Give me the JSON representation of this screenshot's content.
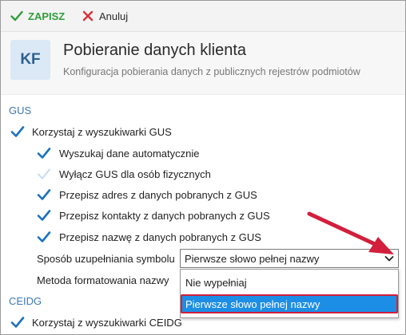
{
  "toolbar": {
    "save_label": "ZAPISZ",
    "cancel_label": "Anuluj"
  },
  "header": {
    "badge": "KF",
    "title": "Pobieranie danych klienta",
    "subtitle": "Konfiguracja pobierania danych z publicznych rejestrów podmiotów"
  },
  "gus": {
    "section_label": "GUS",
    "use_search": {
      "label": "Korzystaj z wyszukiwarki GUS",
      "checked": true
    },
    "options": [
      {
        "label": "Wyszukaj dane automatycznie",
        "checked": true
      },
      {
        "label": "Wyłącz GUS dla osób fizycznych",
        "checked": false
      },
      {
        "label": "Przepisz adres z danych pobranych z GUS",
        "checked": true
      },
      {
        "label": "Przepisz kontakty z danych pobranych z GUS",
        "checked": true
      },
      {
        "label": "Przepisz nazwę z danych pobranych z GUS",
        "checked": true
      }
    ],
    "symbol_field": {
      "label": "Sposób uzupełniania symbolu",
      "value": "Pierwsze słowo pełnej nazwy",
      "dropdown_options": [
        "Nie wypełniaj",
        "Pierwsze słowo pełnej nazwy"
      ],
      "highlighted_option": "Pierwsze słowo pełnej nazwy"
    },
    "format_field": {
      "label": "Metoda formatowania nazwy"
    }
  },
  "ceidg": {
    "section_label": "CEIDG",
    "use_search": {
      "label": "Korzystaj z wyszukiwarki CEIDG",
      "checked": true
    }
  },
  "colors": {
    "accent_blue": "#3d78b5",
    "check_blue": "#1b72c0",
    "save_green": "#2f9e3a",
    "cancel_red": "#d9303a",
    "highlight_blue": "#1d8ee6",
    "annotation_red": "#d21f3c"
  },
  "icons": {
    "save": "check-icon",
    "cancel": "x-icon",
    "dropdown": "chevron-down-icon",
    "annotation": "red-arrow-icon"
  }
}
